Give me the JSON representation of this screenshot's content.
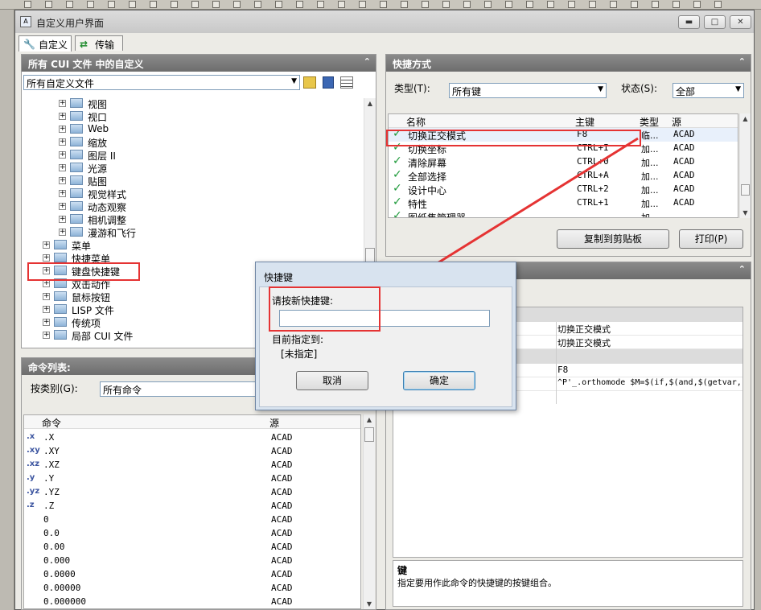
{
  "window": {
    "title": "自定义用户界面"
  },
  "tabs": [
    {
      "label": "自定义",
      "active": true
    },
    {
      "label": "传输",
      "active": false
    }
  ],
  "left_panel": {
    "header": "所有 CUI 文件 中的自定义",
    "file_filter": "所有自定义文件",
    "tree": [
      {
        "label": "视图",
        "level": 2
      },
      {
        "label": "视口",
        "level": 2
      },
      {
        "label": "Web",
        "level": 2
      },
      {
        "label": "缩放",
        "level": 2
      },
      {
        "label": "图层 II",
        "level": 2
      },
      {
        "label": "光源",
        "level": 2
      },
      {
        "label": "贴图",
        "level": 2
      },
      {
        "label": "视觉样式",
        "level": 2
      },
      {
        "label": "动态观察",
        "level": 2
      },
      {
        "label": "相机调整",
        "level": 2
      },
      {
        "label": "漫游和飞行",
        "level": 2
      },
      {
        "label": "菜单",
        "level": 1
      },
      {
        "label": "快捷菜单",
        "level": 1
      },
      {
        "label": "键盘快捷键",
        "level": 1
      },
      {
        "label": "双击动作",
        "level": 1
      },
      {
        "label": "鼠标按钮",
        "level": 1
      },
      {
        "label": "LISP 文件",
        "level": 1
      },
      {
        "label": "传统项",
        "level": 1
      },
      {
        "label": "局部 CUI 文件",
        "level": 1
      }
    ]
  },
  "command_panel": {
    "header": "命令列表:",
    "filter_label": "按类别(G):",
    "filter_value": "所有命令",
    "columns": [
      "命令",
      "源"
    ],
    "rows": [
      {
        "badge": ".x",
        "name": ".X",
        "source": "ACAD"
      },
      {
        "badge": ".xy",
        "name": ".XY",
        "source": "ACAD"
      },
      {
        "badge": ".xz",
        "name": ".XZ",
        "source": "ACAD"
      },
      {
        "badge": ".y",
        "name": ".Y",
        "source": "ACAD"
      },
      {
        "badge": ".yz",
        "name": ".YZ",
        "source": "ACAD"
      },
      {
        "badge": ".z",
        "name": ".Z",
        "source": "ACAD"
      },
      {
        "badge": "",
        "name": "0",
        "source": "ACAD"
      },
      {
        "badge": "",
        "name": "0.0",
        "source": "ACAD"
      },
      {
        "badge": "",
        "name": "0.00",
        "source": "ACAD"
      },
      {
        "badge": "",
        "name": "0.000",
        "source": "ACAD"
      },
      {
        "badge": "",
        "name": "0.0000",
        "source": "ACAD"
      },
      {
        "badge": "",
        "name": "0.00000",
        "source": "ACAD"
      },
      {
        "badge": "",
        "name": "0.000000",
        "source": "ACAD"
      }
    ]
  },
  "shortcuts_panel": {
    "header": "快捷方式",
    "type_label": "类型(T):",
    "type_value": "所有键",
    "status_label": "状态(S):",
    "status_value": "全部",
    "columns": [
      "名称",
      "主键",
      "类型",
      "源"
    ],
    "rows": [
      {
        "name": "切换正交模式",
        "key": "F8",
        "type": "临...",
        "source": "ACAD"
      },
      {
        "name": "切换坐标",
        "key": "CTRL+I",
        "type": "加...",
        "source": "ACAD"
      },
      {
        "name": "清除屏幕",
        "key": "CTRL+0",
        "type": "加...",
        "source": "ACAD"
      },
      {
        "name": "全部选择",
        "key": "CTRL+A",
        "type": "加...",
        "source": "ACAD"
      },
      {
        "name": "设计中心",
        "key": "CTRL+2",
        "type": "加...",
        "source": "ACAD"
      },
      {
        "name": "特性",
        "key": "CTRL+1",
        "type": "加...",
        "source": "ACAD"
      },
      {
        "name": "图纸集管理器",
        "key": "",
        "type": "加...",
        "source": ""
      }
    ],
    "copy_button": "复制到剪贴板",
    "print_button": "打印(P)"
  },
  "properties": {
    "rows": [
      {
        "label": "",
        "value": "切换正交模式"
      },
      {
        "label": "",
        "value": "切换正交模式"
      },
      {
        "label": "",
        "value": "F8"
      },
      {
        "label": "",
        "value": "^P'_.orthomode $M=$(if,$(and,$(getvar,"
      }
    ],
    "help_title": "键",
    "help_text": "指定要用作此命令的快捷键的按键组合。"
  },
  "dialog": {
    "title": "快捷键",
    "prompt": "请按新快捷键:",
    "input_value": "",
    "current_label": "目前指定到:",
    "current_value": "[未指定]",
    "cancel": "取消",
    "ok": "确定"
  },
  "colors": {
    "highlight": "#e53333",
    "check": "#1e9a3a",
    "panel_header": "#7a7a7a"
  }
}
